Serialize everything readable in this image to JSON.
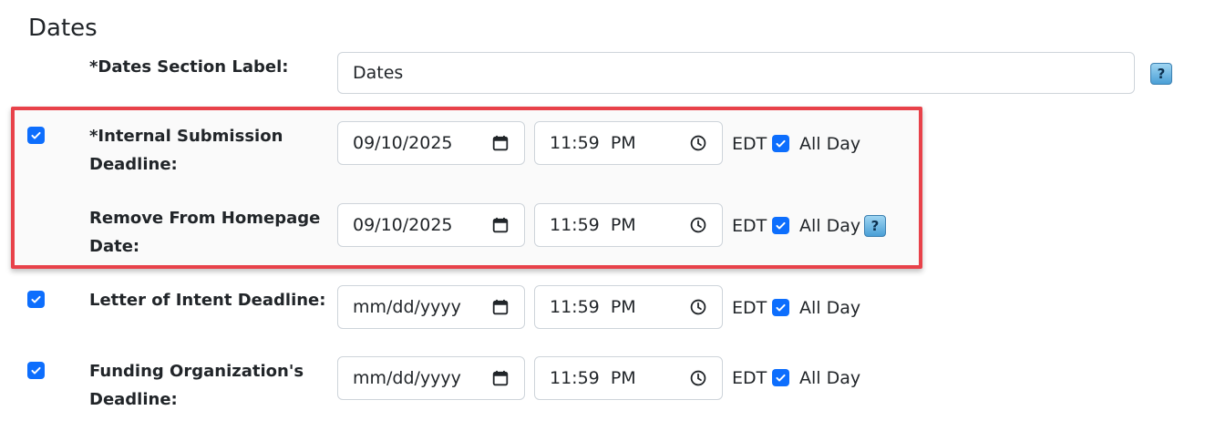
{
  "section": {
    "title": "Dates"
  },
  "label_field": {
    "label": "*Dates Section Label:",
    "value": "Dates"
  },
  "help": {
    "glyph": "?"
  },
  "check_glyph": "✓",
  "rows": [
    {
      "label_line1": "*Internal Submission",
      "label_line2": "Deadline:",
      "checked": true,
      "date": "09/10/2025",
      "time": "11:59  PM",
      "timezone": "EDT",
      "all_day_label": "All Day",
      "all_day_checked": true
    },
    {
      "label_line1": "Remove From Homepage",
      "label_line2": "Date:",
      "checked": false,
      "date": "09/10/2025",
      "time": "11:59  PM",
      "timezone": "EDT",
      "all_day_label": "All Day",
      "all_day_checked": true
    },
    {
      "label_line1": "Letter of Intent Deadline:",
      "label_line2": "",
      "checked": true,
      "date": "mm/dd/yyyy",
      "time": "11:59  PM",
      "timezone": "EDT",
      "all_day_label": "All Day",
      "all_day_checked": true
    },
    {
      "label_line1": "Funding Organization's",
      "label_line2": "Deadline:",
      "checked": true,
      "date": "mm/dd/yyyy",
      "time": "11:59  PM",
      "timezone": "EDT",
      "all_day_label": "All Day",
      "all_day_checked": true
    }
  ],
  "colors": {
    "checkbox": "#0d6efd",
    "highlight_border": "#e8424a",
    "input_border": "#ced4da"
  }
}
